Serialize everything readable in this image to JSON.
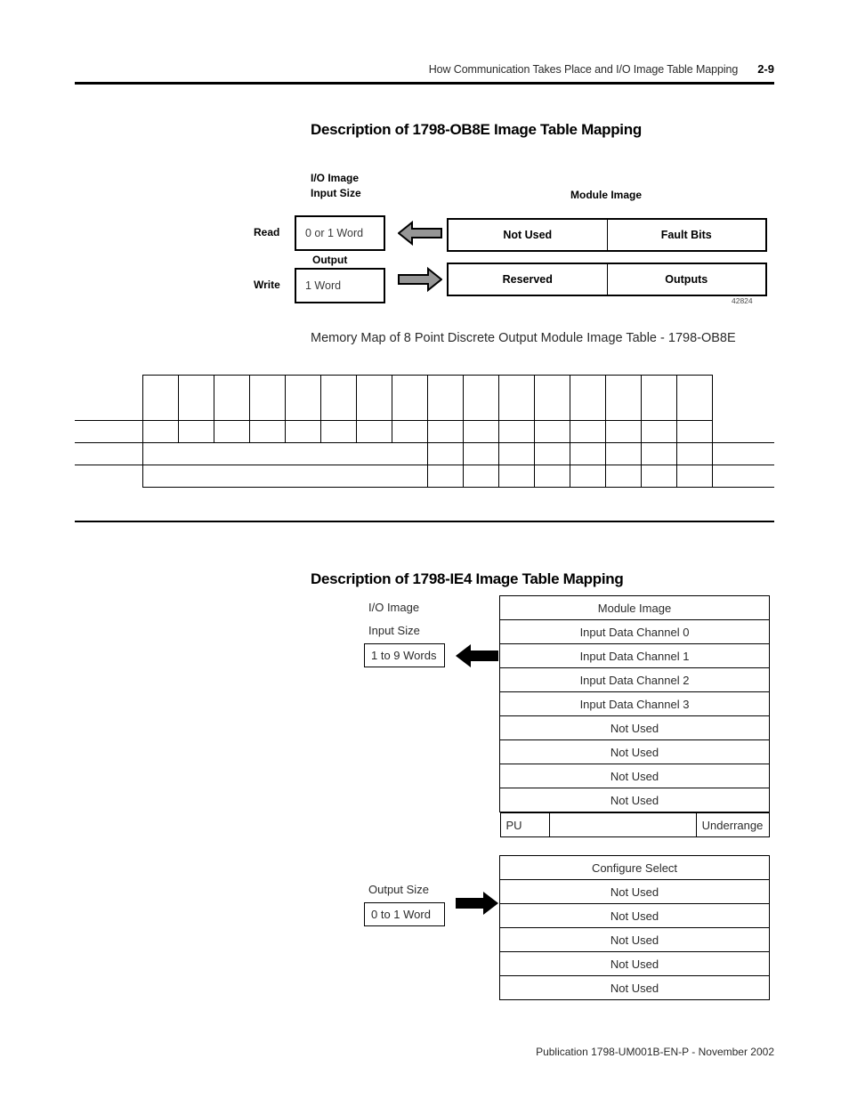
{
  "header": {
    "title": "How Communication Takes Place and I/O Image Table Mapping",
    "page_number": "2-9"
  },
  "ob8e_section": {
    "title": "Description of 1798-OB8E Image Table Mapping",
    "labels": {
      "io_image": "I/O Image",
      "input_size": "Input Size",
      "module_image": "Module Image",
      "read": "Read",
      "write": "Write",
      "output": "Output"
    },
    "read_size": "0 or 1 Word",
    "write_size": "1 Word",
    "read_row": {
      "left": "Not Used",
      "right": "Fault Bits"
    },
    "write_row": {
      "left": "Reserved",
      "right": "Outputs"
    },
    "figure_id": "42824",
    "memory_map_caption": "Memory Map of 8 Point Discrete Output Module Image Table - 1798-OB8E",
    "memory_map_grid": {
      "bit_columns": 16,
      "rows": [
        {
          "label": "",
          "cells": [
            "",
            "",
            "",
            "",
            "",
            "",
            "",
            "",
            "",
            "",
            "",
            "",
            "",
            "",
            "",
            ""
          ],
          "tail": ""
        },
        {
          "label": "",
          "cells": [
            "",
            "",
            "",
            "",
            "",
            "",
            "",
            "",
            "",
            "",
            "",
            "",
            "",
            "",
            "",
            ""
          ],
          "tail": ""
        },
        {
          "label": "",
          "span_cells": 8,
          "cells": [
            "",
            "",
            "",
            "",
            "",
            "",
            "",
            ""
          ],
          "tail": ""
        },
        {
          "label": "",
          "span_cells": 8,
          "cells": [
            "",
            "",
            "",
            "",
            "",
            "",
            "",
            ""
          ],
          "tail": ""
        }
      ]
    }
  },
  "ie4_section": {
    "title": "Description of 1798-IE4 Image Table Mapping",
    "labels": {
      "io_image": "I/O Image",
      "input_size": "Input Size",
      "output_size": "Output Size"
    },
    "input_size_value": "1 to 9 Words",
    "output_size_value": "0 to 1 Word",
    "input_table": [
      "Module Image",
      "Input Data Channel 0",
      "Input Data Channel 1",
      "Input Data Channel 2",
      "Input Data Channel 3",
      "Not Used",
      "Not Used",
      "Not Used",
      "Not Used"
    ],
    "input_table_last_row": {
      "left": "PU",
      "middle": "",
      "right": "Underrange"
    },
    "output_table": [
      "Configure Select",
      "Not Used",
      "Not Used",
      "Not Used",
      "Not Used",
      "Not Used"
    ]
  },
  "footer": {
    "publication": "Publication 1798-UM001B-EN-P - November 2002"
  },
  "colors": {
    "arrow_gray_fill": "#969696",
    "arrow_black_fill": "#000000",
    "rule": "#000000",
    "body_text": "#2b2b2b"
  }
}
